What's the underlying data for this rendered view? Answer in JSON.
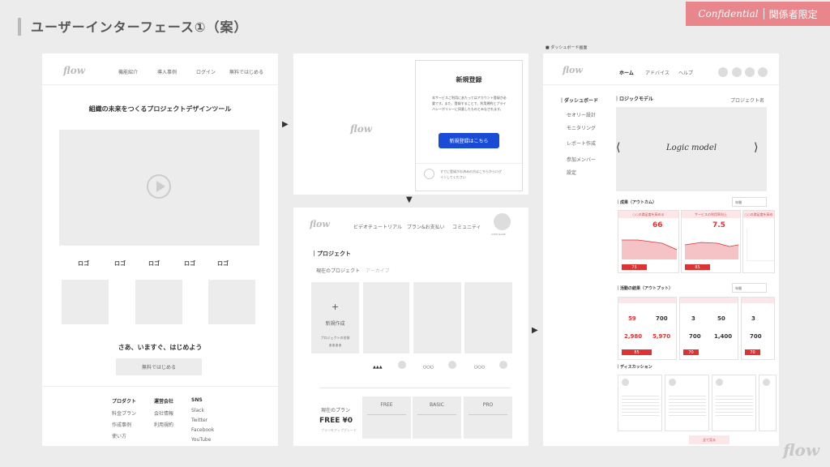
{
  "page": {
    "title": "ユーザーインターフェース①（案）",
    "confidential": "Confidential",
    "confidential_jp": "関係者限定",
    "footer_logo": "flow"
  },
  "landing": {
    "logo": "flow",
    "nav": [
      "機能紹介",
      "導入事例",
      "ログイン",
      "無料ではじめる"
    ],
    "headline": "組織の未来をつくるプロジェクトデザインツール",
    "logos": [
      "ロゴ",
      "ロゴ",
      "ロゴ",
      "ロゴ",
      "ロゴ"
    ],
    "cta_heading": "さあ、いますぐ、はじめよう",
    "cta_button": "無料ではじめる",
    "footer_cols": [
      {
        "head": "プロダクト",
        "items": [
          "料金プラン",
          "作成事例",
          "使い方"
        ]
      },
      {
        "head": "運営会社",
        "items": [
          "会社情報",
          "利用規約"
        ]
      },
      {
        "head": "SNS",
        "items": [
          "Slack",
          "Twitter",
          "Facebook",
          "YouTube"
        ]
      }
    ]
  },
  "signup": {
    "logo": "flow",
    "title": "新規登録",
    "body": "本サービスご利用にあたってはアカウント登録が必要です。また、登録することで、利用規約とプライバシーポリシーに同意したものとみなされます。",
    "button": "新規登録はこちら",
    "login_note": "すでに登録がお済みの方はこちらからログインしてください"
  },
  "projects": {
    "logo": "flow",
    "nav": [
      "ビデオチュートリアル",
      "プラン&お支払い",
      "コミュニティ"
    ],
    "user_label": "USER NAME",
    "section": "プロジェクト",
    "tabs": [
      "現在のプロジェクト",
      "アーカイブ"
    ],
    "new_label": "新規作成",
    "new_sub": "プロジェクトの名前",
    "new_meta": "ああああ",
    "card_marks": [
      "▲▲▲",
      "○○○",
      "○○○"
    ],
    "card_user": "USER NAME",
    "plan_label": "現在のプラン",
    "plan_value": "FREE ¥0",
    "plan_note": "プランをアップグレード",
    "plans": [
      "FREE",
      "BASIC",
      "PRO"
    ]
  },
  "dashboard": {
    "caption": "ダッシュボード画面",
    "logo": "flow",
    "nav": [
      "ホーム",
      "アドバイス",
      "ヘルプ"
    ],
    "sidebar_title": "ダッシュボード",
    "sidebar": [
      "セオリー設計",
      "モニタリング",
      "レポート作成",
      "参加メンバー",
      "設定"
    ],
    "logic_title": "ロジックモデル",
    "project_name": "プロジェクト名",
    "logic_text": "Logic model",
    "outcome_title": "成果（アウトカム）",
    "outcome_select": "年間",
    "outcome_heads": [
      "○○の満足度を高める",
      "サービスの利用率向上",
      "○○の満足度を高める"
    ],
    "outcome_vals": [
      "66",
      "7.5",
      ""
    ],
    "outcome_bar": [
      "75",
      "85",
      ""
    ],
    "activity_title": "活動の結果（アウトプット）",
    "activity_select": "年間",
    "activity_cards": [
      {
        "top": [
          "59",
          "700"
        ],
        "bottom": [
          "2,980",
          "5,970"
        ],
        "bar": "85"
      },
      {
        "top": [
          "3",
          "50"
        ],
        "bottom": [
          "700",
          "1,400"
        ],
        "bar": "70"
      },
      {
        "top": [
          "3",
          "50"
        ],
        "bottom": [
          "700",
          "1,400"
        ],
        "bar": "70"
      }
    ],
    "discussion_title": "ディスカッション",
    "more_button": "全て見る"
  }
}
